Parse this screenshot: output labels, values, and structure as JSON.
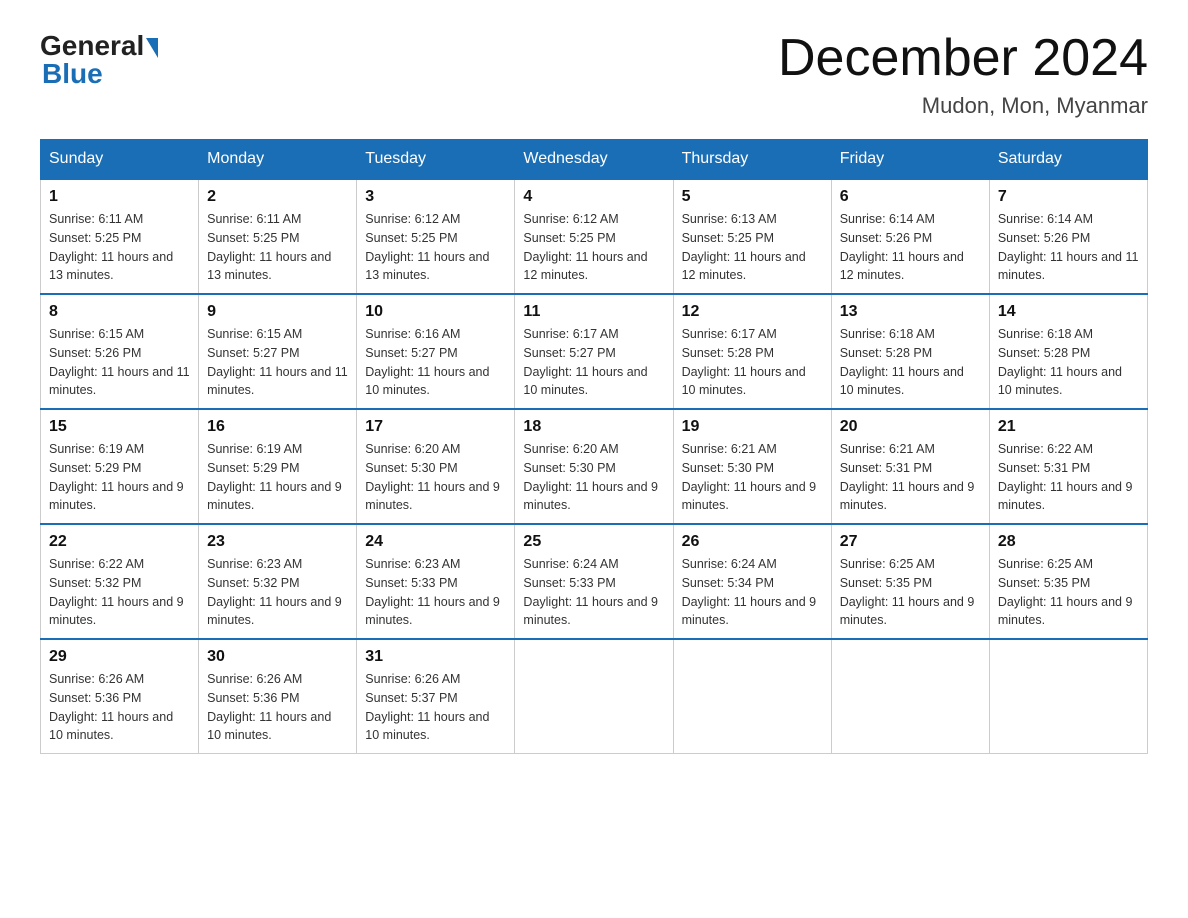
{
  "header": {
    "logo_general": "General",
    "logo_blue": "Blue",
    "month_title": "December 2024",
    "location": "Mudon, Mon, Myanmar"
  },
  "days_of_week": [
    "Sunday",
    "Monday",
    "Tuesday",
    "Wednesday",
    "Thursday",
    "Friday",
    "Saturday"
  ],
  "weeks": [
    [
      {
        "day": 1,
        "sunrise": "6:11 AM",
        "sunset": "5:25 PM",
        "daylight": "11 hours and 13 minutes."
      },
      {
        "day": 2,
        "sunrise": "6:11 AM",
        "sunset": "5:25 PM",
        "daylight": "11 hours and 13 minutes."
      },
      {
        "day": 3,
        "sunrise": "6:12 AM",
        "sunset": "5:25 PM",
        "daylight": "11 hours and 13 minutes."
      },
      {
        "day": 4,
        "sunrise": "6:12 AM",
        "sunset": "5:25 PM",
        "daylight": "11 hours and 12 minutes."
      },
      {
        "day": 5,
        "sunrise": "6:13 AM",
        "sunset": "5:25 PM",
        "daylight": "11 hours and 12 minutes."
      },
      {
        "day": 6,
        "sunrise": "6:14 AM",
        "sunset": "5:26 PM",
        "daylight": "11 hours and 12 minutes."
      },
      {
        "day": 7,
        "sunrise": "6:14 AM",
        "sunset": "5:26 PM",
        "daylight": "11 hours and 11 minutes."
      }
    ],
    [
      {
        "day": 8,
        "sunrise": "6:15 AM",
        "sunset": "5:26 PM",
        "daylight": "11 hours and 11 minutes."
      },
      {
        "day": 9,
        "sunrise": "6:15 AM",
        "sunset": "5:27 PM",
        "daylight": "11 hours and 11 minutes."
      },
      {
        "day": 10,
        "sunrise": "6:16 AM",
        "sunset": "5:27 PM",
        "daylight": "11 hours and 10 minutes."
      },
      {
        "day": 11,
        "sunrise": "6:17 AM",
        "sunset": "5:27 PM",
        "daylight": "11 hours and 10 minutes."
      },
      {
        "day": 12,
        "sunrise": "6:17 AM",
        "sunset": "5:28 PM",
        "daylight": "11 hours and 10 minutes."
      },
      {
        "day": 13,
        "sunrise": "6:18 AM",
        "sunset": "5:28 PM",
        "daylight": "11 hours and 10 minutes."
      },
      {
        "day": 14,
        "sunrise": "6:18 AM",
        "sunset": "5:28 PM",
        "daylight": "11 hours and 10 minutes."
      }
    ],
    [
      {
        "day": 15,
        "sunrise": "6:19 AM",
        "sunset": "5:29 PM",
        "daylight": "11 hours and 9 minutes."
      },
      {
        "day": 16,
        "sunrise": "6:19 AM",
        "sunset": "5:29 PM",
        "daylight": "11 hours and 9 minutes."
      },
      {
        "day": 17,
        "sunrise": "6:20 AM",
        "sunset": "5:30 PM",
        "daylight": "11 hours and 9 minutes."
      },
      {
        "day": 18,
        "sunrise": "6:20 AM",
        "sunset": "5:30 PM",
        "daylight": "11 hours and 9 minutes."
      },
      {
        "day": 19,
        "sunrise": "6:21 AM",
        "sunset": "5:30 PM",
        "daylight": "11 hours and 9 minutes."
      },
      {
        "day": 20,
        "sunrise": "6:21 AM",
        "sunset": "5:31 PM",
        "daylight": "11 hours and 9 minutes."
      },
      {
        "day": 21,
        "sunrise": "6:22 AM",
        "sunset": "5:31 PM",
        "daylight": "11 hours and 9 minutes."
      }
    ],
    [
      {
        "day": 22,
        "sunrise": "6:22 AM",
        "sunset": "5:32 PM",
        "daylight": "11 hours and 9 minutes."
      },
      {
        "day": 23,
        "sunrise": "6:23 AM",
        "sunset": "5:32 PM",
        "daylight": "11 hours and 9 minutes."
      },
      {
        "day": 24,
        "sunrise": "6:23 AM",
        "sunset": "5:33 PM",
        "daylight": "11 hours and 9 minutes."
      },
      {
        "day": 25,
        "sunrise": "6:24 AM",
        "sunset": "5:33 PM",
        "daylight": "11 hours and 9 minutes."
      },
      {
        "day": 26,
        "sunrise": "6:24 AM",
        "sunset": "5:34 PM",
        "daylight": "11 hours and 9 minutes."
      },
      {
        "day": 27,
        "sunrise": "6:25 AM",
        "sunset": "5:35 PM",
        "daylight": "11 hours and 9 minutes."
      },
      {
        "day": 28,
        "sunrise": "6:25 AM",
        "sunset": "5:35 PM",
        "daylight": "11 hours and 9 minutes."
      }
    ],
    [
      {
        "day": 29,
        "sunrise": "6:26 AM",
        "sunset": "5:36 PM",
        "daylight": "11 hours and 10 minutes."
      },
      {
        "day": 30,
        "sunrise": "6:26 AM",
        "sunset": "5:36 PM",
        "daylight": "11 hours and 10 minutes."
      },
      {
        "day": 31,
        "sunrise": "6:26 AM",
        "sunset": "5:37 PM",
        "daylight": "11 hours and 10 minutes."
      },
      null,
      null,
      null,
      null
    ]
  ]
}
